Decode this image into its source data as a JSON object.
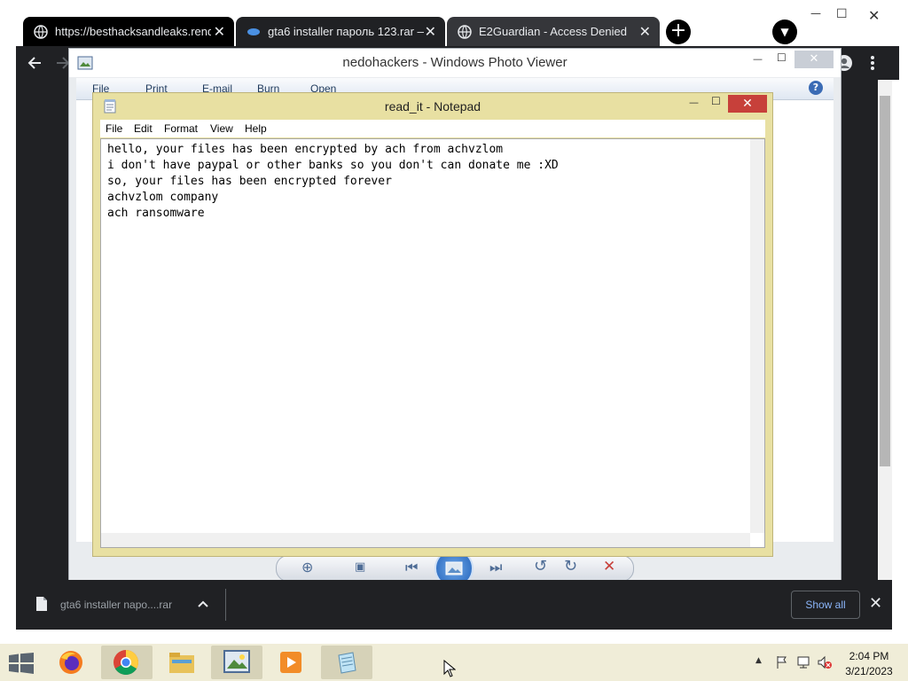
{
  "browser": {
    "tabs": [
      {
        "title": "https://besthacksandleaks.render",
        "close": "✕"
      },
      {
        "title": "gta6 installer пароль 123.rar — ",
        "close": "✕"
      },
      {
        "title": "E2Guardian - Access Denied",
        "close": "✕"
      }
    ],
    "new_tab": "+",
    "tab_search": "▼",
    "window_controls": {
      "minimize": "—",
      "maximize": "☐",
      "close": "✕"
    }
  },
  "photo_viewer": {
    "title": "nedohackers - Windows Photo Viewer",
    "menu": [
      "File",
      "Print",
      "E-mail",
      "Burn",
      "Open"
    ],
    "help": "?",
    "window_controls": {
      "minimize": "—",
      "maximize": "☐",
      "close": "✕"
    }
  },
  "notepad": {
    "title": "read_it - Notepad",
    "menu": [
      "File",
      "Edit",
      "Format",
      "View",
      "Help"
    ],
    "lines": [
      "hello, your files has been encrypted by ach from achvzlom",
      "i don't have paypal or other banks so you don't can donate me :XD",
      "so, your files has been encrypted forever",
      "achvzlom company",
      "ach ransomware"
    ],
    "window_controls": {
      "minimize": "—",
      "maximize": "☐",
      "close": "✕"
    }
  },
  "downloads": {
    "item": "gta6 installer napo....rar",
    "show_all": "Show all",
    "close": "✕"
  },
  "taskbar": {
    "time": "2:04 PM",
    "date": "3/21/2023",
    "apps": [
      "start-icon",
      "firefox-icon",
      "chrome-icon",
      "file-explorer-icon",
      "photo-viewer-icon",
      "media-player-icon",
      "notepad-icon"
    ]
  },
  "colors": {
    "chrome_dark": "#202124",
    "notepad_frame": "#e8e0a2",
    "close_red": "#c7403a",
    "taskbar": "#f0edd8",
    "link_blue": "#8ab4f8"
  }
}
